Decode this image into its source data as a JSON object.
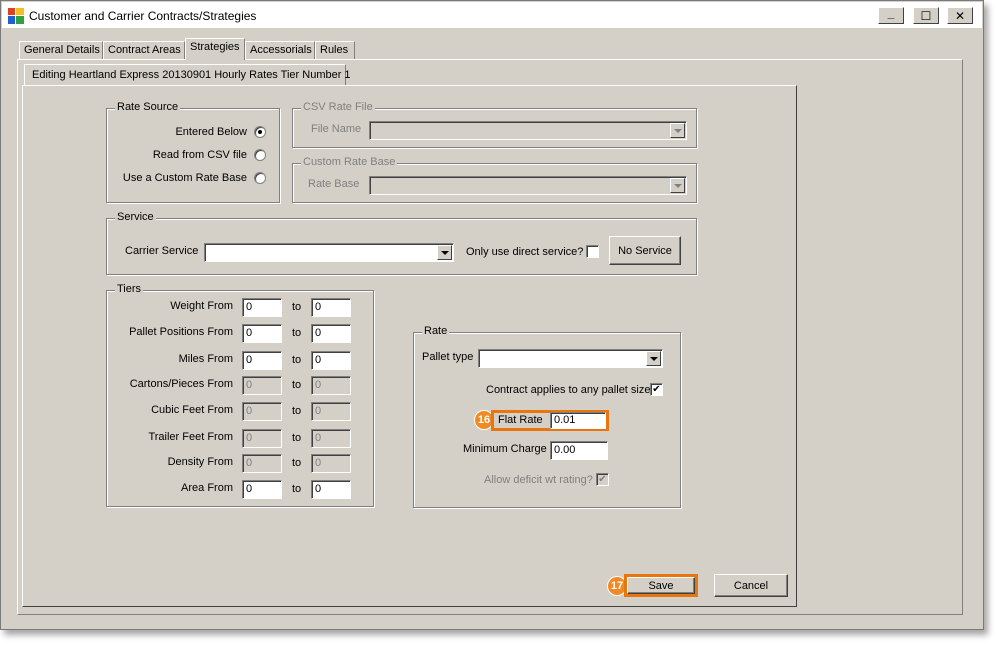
{
  "window": {
    "title": "Customer and Carrier Contracts/Strategies",
    "controls": {
      "minimize": "_",
      "maximize": "☐",
      "close": "✕"
    }
  },
  "tabs": [
    {
      "label": "General Details"
    },
    {
      "label": "Contract Areas"
    },
    {
      "label": "Strategies",
      "active": true
    },
    {
      "label": "Accessorials"
    },
    {
      "label": "Rules"
    }
  ],
  "subtab": {
    "label": "Editing Heartland Express 20130901 Hourly Rates Tier Number 1"
  },
  "rate_source": {
    "legend": "Rate Source",
    "options": [
      {
        "label": "Entered Below",
        "selected": true
      },
      {
        "label": "Read from CSV file",
        "selected": false
      },
      {
        "label": "Use a Custom Rate Base",
        "selected": false
      }
    ]
  },
  "csv_rate_file": {
    "legend": "CSV Rate File",
    "file_name_label": "File Name",
    "file_name_value": ""
  },
  "custom_rate_base": {
    "legend": "Custom Rate Base",
    "rate_base_label": "Rate Base",
    "rate_base_value": ""
  },
  "service": {
    "legend": "Service",
    "carrier_service_label": "Carrier Service",
    "carrier_service_value": "",
    "direct_label": "Only use direct service?",
    "direct_checked": false,
    "no_service_button": "No Service"
  },
  "tiers": {
    "legend": "Tiers",
    "to_label": "to",
    "rows": [
      {
        "label": "Weight From",
        "from": "0",
        "to": "0",
        "enabled": true
      },
      {
        "label": "Pallet Positions From",
        "from": "0",
        "to": "0",
        "enabled": true
      },
      {
        "label": "Miles From",
        "from": "0",
        "to": "0",
        "enabled": true
      },
      {
        "label": "Cartons/Pieces From",
        "from": "0",
        "to": "0",
        "enabled": false
      },
      {
        "label": "Cubic Feet From",
        "from": "0",
        "to": "0",
        "enabled": false
      },
      {
        "label": "Trailer Feet From",
        "from": "0",
        "to": "0",
        "enabled": false
      },
      {
        "label": "Density From",
        "from": "0",
        "to": "0",
        "enabled": false
      },
      {
        "label": "Area From",
        "from": "0",
        "to": "0",
        "enabled": true
      }
    ]
  },
  "rate": {
    "legend": "Rate",
    "pallet_type_label": "Pallet type",
    "pallet_type_value": "",
    "any_pallet_label": "Contract applies to any pallet size",
    "any_pallet_checked": true,
    "flat_rate_label": "Flat Rate",
    "flat_rate_value": "0.01",
    "minimum_charge_label": "Minimum Charge",
    "minimum_charge_value": "0.00",
    "deficit_label": "Allow deficit wt rating?",
    "deficit_checked": true
  },
  "footer": {
    "save_label": "Save",
    "cancel_label": "Cancel"
  },
  "callouts": {
    "flat_rate_step": "16",
    "save_step": "17"
  },
  "colors": {
    "highlight": "#e8750e",
    "badge": "#f08a24",
    "face": "#d4d0c8"
  }
}
